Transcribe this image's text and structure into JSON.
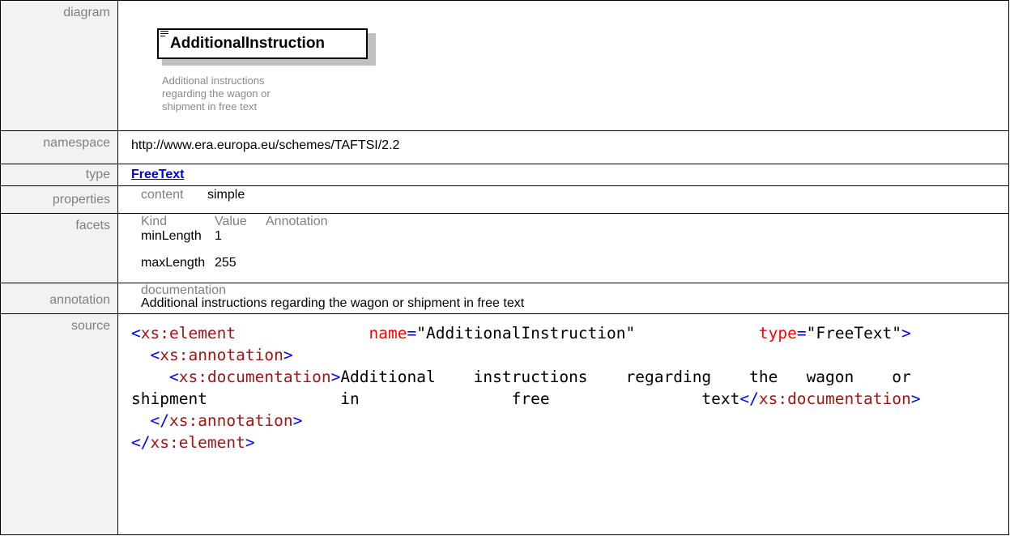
{
  "rows": {
    "diagram": {
      "label": "diagram",
      "element_name": "AdditionalInstruction",
      "doc_lines": [
        "Additional instructions",
        "regarding the wagon or",
        "shipment in free text"
      ]
    },
    "namespace": {
      "label": "namespace",
      "value": "http://www.era.europa.eu/schemes/TAFTSI/2.2"
    },
    "type": {
      "label": "type",
      "value": "FreeText"
    },
    "properties": {
      "label": "properties",
      "key": "content",
      "value": "simple"
    },
    "facets": {
      "label": "facets",
      "headers": [
        "Kind",
        "Value",
        "Annotation"
      ],
      "items": [
        {
          "kind": "minLength",
          "value": "1"
        },
        {
          "kind": "maxLength",
          "value": "255"
        }
      ]
    },
    "annotation": {
      "label": "annotation",
      "head": "documentation",
      "text": "Additional instructions regarding the wagon or shipment in free text"
    },
    "source": {
      "label": "source",
      "open_tag": "xs:element",
      "attr_name": "name",
      "attr_name_value": "\"AdditionalInstruction\"",
      "attr_type": "type",
      "attr_type_value": "\"FreeText\"",
      "annotation_tag": "xs:annotation",
      "documentation_tag": "xs:documentation",
      "doc_line1": "Additional    instructions    regarding    the   wagon    or",
      "doc_line2": "shipment              in                free                text",
      "close_element_tag": "xs:element"
    }
  }
}
